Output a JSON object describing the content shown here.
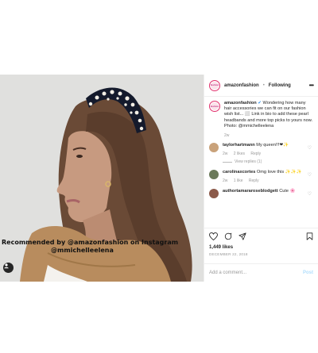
{
  "header": {
    "username": "amazonfashion",
    "separator": "•",
    "follow_status": "Following",
    "more": "•••",
    "logo_text": "fashion"
  },
  "photo": {
    "overlay_line1": "Recommended by @amazonfashion on Instagram",
    "overlay_line2": "@mmichelleelena"
  },
  "caption": {
    "username": "amazonfashion",
    "text": "Wondering how many hair accessories we can fit on our fashion wish list... ⬜ Link in bio to add these pearl headbands and more top picks to yours now. Photo: @mmichelleelena",
    "time": "2w"
  },
  "comments": [
    {
      "username": "taylorhartmann",
      "text": "My queen!!!❤✨",
      "time": "2w",
      "likes": "2 likes",
      "reply": "Reply",
      "view_replies": "View replies (1)",
      "avatar_color": "#c9a27a"
    },
    {
      "username": "carolinaxcortes",
      "text": "Omg love this ✨✨✨",
      "time": "2w",
      "likes": "1 like",
      "reply": "Reply",
      "avatar_color": "#6b7a5a"
    },
    {
      "username": "authortamararoseblodgett",
      "text": "Cute 🌸",
      "avatar_color": "#8b5a4a"
    }
  ],
  "actions": {
    "likes_count": "1,449 likes",
    "date": "DECEMBER 22, 2018"
  },
  "add_comment": {
    "placeholder": "Add a comment...",
    "post_label": "Post"
  },
  "colors": {
    "verified": "#3897f0",
    "brand_ring": "#e1306c"
  }
}
